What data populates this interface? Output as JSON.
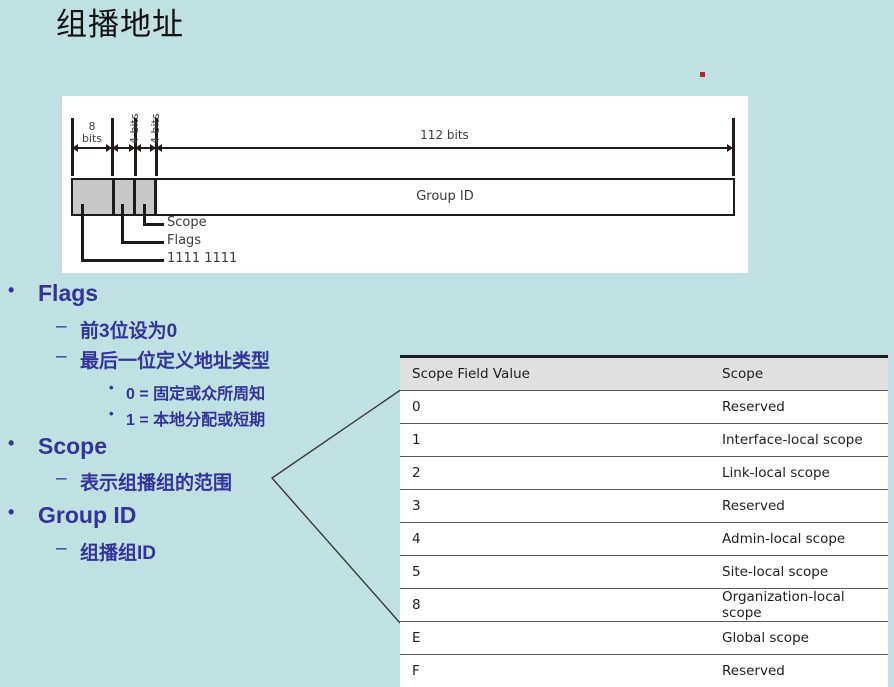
{
  "slide": {
    "title": "组播地址",
    "background_color": "#bfe1e2",
    "accent_text_color": "#333399"
  },
  "marker": {
    "name": "red-dot",
    "color": "#c0202a"
  },
  "diagram": {
    "name": "ipv6-multicast-address-format",
    "field_widths": [
      {
        "label_line1": "8",
        "label_line2": "bits"
      },
      {
        "label": "4 bits"
      },
      {
        "label": "4 bits"
      },
      {
        "label": "112 bits"
      }
    ],
    "width_8bits_line1": "8",
    "width_8bits_line2": "bits",
    "width_flags": "4 bits",
    "width_scope": "4 bits",
    "width_groupid": "112 bits",
    "groupid_box_label": "Group ID",
    "callouts": [
      {
        "label": "Scope"
      },
      {
        "label": "Flags"
      },
      {
        "label": "1111 1111"
      }
    ],
    "callout_scope": "Scope",
    "callout_flags": "Flags",
    "callout_prefix": "1111 1111"
  },
  "bullets": [
    {
      "level": 1,
      "mark": "•",
      "text": "Flags"
    },
    {
      "level": 2,
      "mark": "–",
      "text": "前3位设为0"
    },
    {
      "level": 2,
      "mark": "–",
      "text": "最后一位定义地址类型"
    },
    {
      "level": 3,
      "mark": "•",
      "text": "0 = 固定或众所周知"
    },
    {
      "level": 3,
      "mark": "•",
      "text": "1 = 本地分配或短期"
    },
    {
      "level": 1,
      "mark": "•",
      "text": "Scope"
    },
    {
      "level": 2,
      "mark": "–",
      "text": "表示组播组的范围"
    },
    {
      "level": 1,
      "mark": "•",
      "text": "Group ID"
    },
    {
      "level": 2,
      "mark": "–",
      "text": "组播组ID"
    }
  ],
  "scope_table": {
    "name": "scope-field-value-table",
    "headers": [
      "Scope Field Value",
      "Scope"
    ],
    "rows": [
      [
        "0",
        "Reserved"
      ],
      [
        "1",
        "Interface-local scope"
      ],
      [
        "2",
        "Link-local scope"
      ],
      [
        "3",
        "Reserved"
      ],
      [
        "4",
        "Admin-local scope"
      ],
      [
        "5",
        "Site-local scope"
      ],
      [
        "8",
        "Organization-local scope"
      ],
      [
        "E",
        "Global scope"
      ],
      [
        "F",
        "Reserved"
      ]
    ]
  }
}
